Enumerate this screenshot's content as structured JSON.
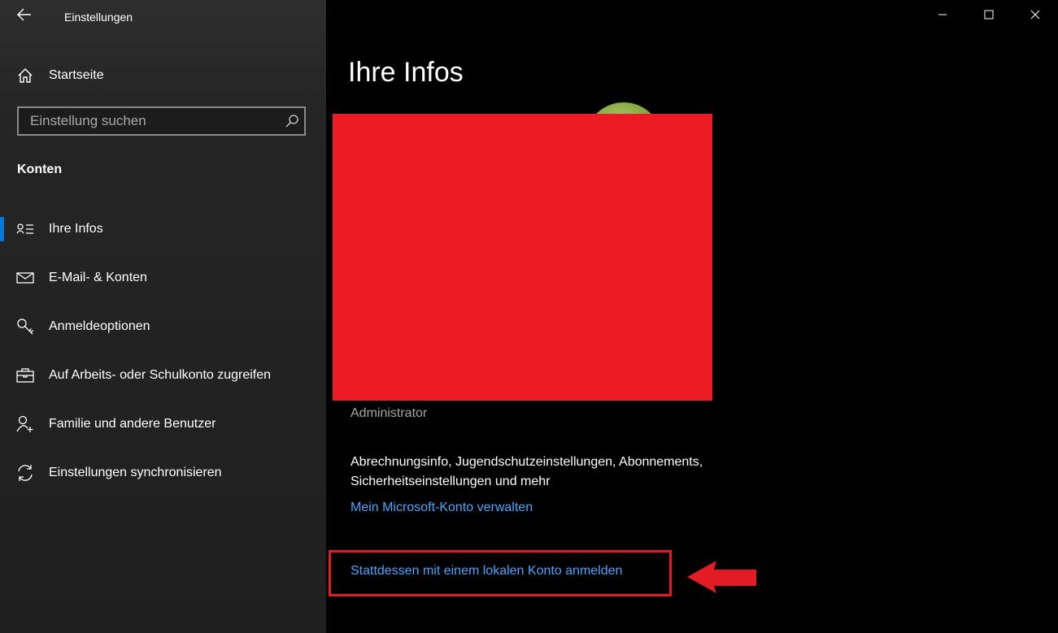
{
  "window": {
    "title": "Einstellungen",
    "controls": {
      "minimize": "minimize-icon",
      "maximize": "maximize-icon",
      "close": "close-icon"
    }
  },
  "sidebar": {
    "back_icon": "back-arrow-icon",
    "home": {
      "label": "Startseite",
      "icon": "home-icon"
    },
    "search": {
      "placeholder": "Einstellung suchen",
      "value": "",
      "icon": "search-icon"
    },
    "section_title": "Konten",
    "items": [
      {
        "label": "Ihre Infos",
        "icon": "person-card-icon",
        "selected": true
      },
      {
        "label": "E-Mail- & Konten",
        "icon": "mail-icon",
        "selected": false
      },
      {
        "label": "Anmeldeoptionen",
        "icon": "key-icon",
        "selected": false
      },
      {
        "label": "Auf Arbeits- oder Schulkonto zugreifen",
        "icon": "briefcase-icon",
        "selected": false
      },
      {
        "label": "Familie und andere Benutzer",
        "icon": "add-person-icon",
        "selected": false
      },
      {
        "label": "Einstellungen synchronisieren",
        "icon": "sync-icon",
        "selected": false
      }
    ],
    "accent_color": "#0078d7"
  },
  "main": {
    "title": "Ihre Infos",
    "role": "Administrator",
    "info_text": "Abrechnungsinfo, Jugendschutzeinstellungen, Abonnements, Sicherheitseinstellungen und mehr",
    "link_ms_account": "Mein Microsoft-Konto verwalten",
    "link_local_account": "Stattdessen mit einem lokalen Konto anmelden",
    "link_color": "#4ca6ff",
    "redaction_color": "#ed1c24",
    "annotation_color": "#e31b23"
  }
}
